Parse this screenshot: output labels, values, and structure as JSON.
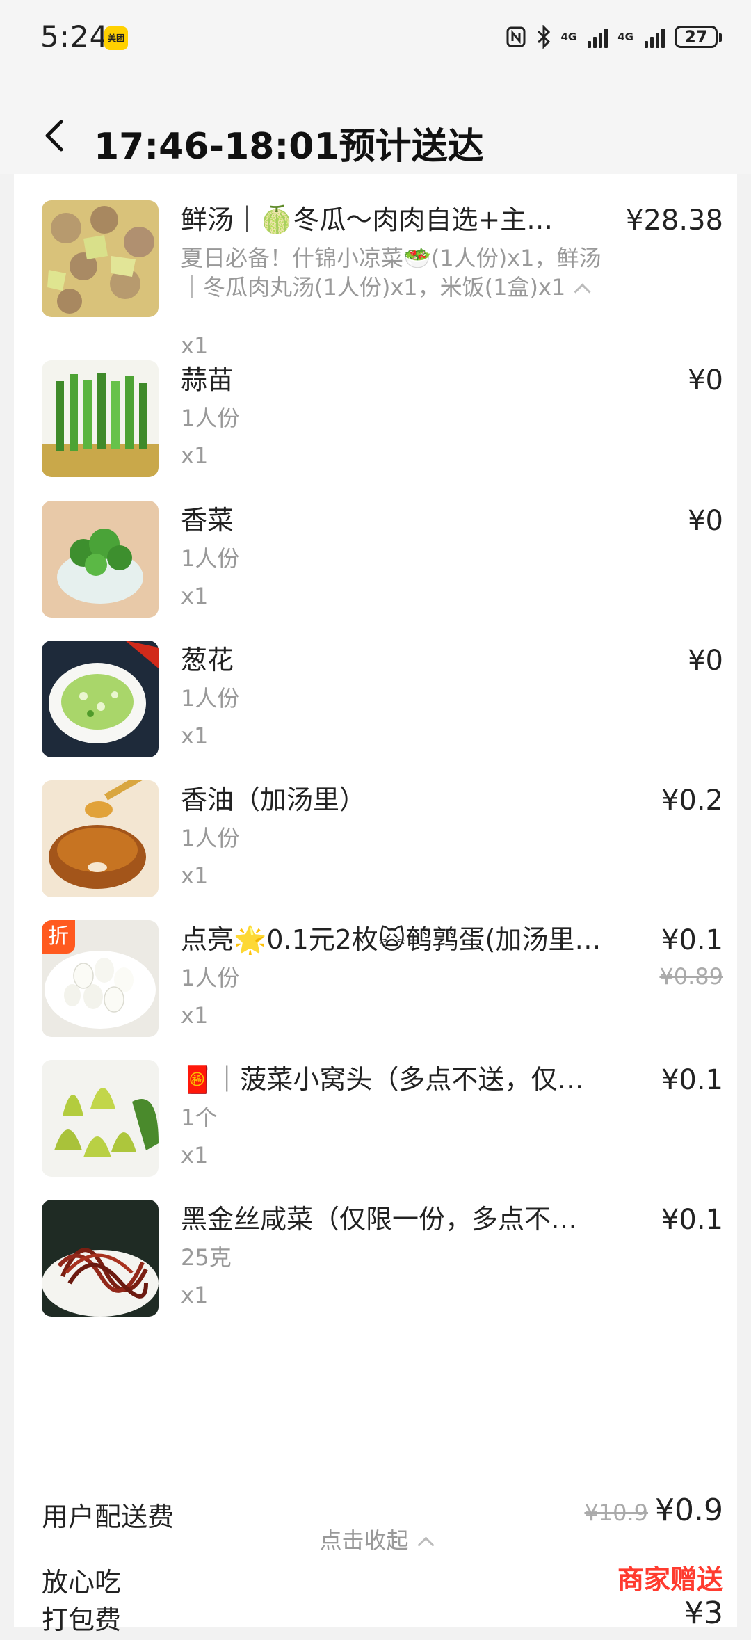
{
  "status_bar": {
    "time": "5:24",
    "app_badge": "美团",
    "network_1": "4G",
    "network_2": "4G",
    "battery": "27"
  },
  "header": {
    "title": "17:46-18:01预计送达"
  },
  "items": [
    {
      "name": "鲜汤｜🍈冬瓜～肉肉自选+主…",
      "spec": "夏日必备！什锦小凉菜🥗(1人份)x1，鲜汤｜冬瓜肉丸汤(1人份)x1，米饭(1盒)x1",
      "qty": "x1",
      "price": "¥28.38"
    },
    {
      "name": "蒜苗",
      "spec": "1人份",
      "qty": "x1",
      "price": "¥0"
    },
    {
      "name": "香菜",
      "spec": "1人份",
      "qty": "x1",
      "price": "¥0"
    },
    {
      "name": "葱花",
      "spec": "1人份",
      "qty": "x1",
      "price": "¥0"
    },
    {
      "name": "香油（加汤里）",
      "spec": "1人份",
      "qty": "x1",
      "price": "¥0.2"
    },
    {
      "name": "点亮🌟0.1元2枚🙀鹌鹑蛋(加汤里…",
      "spec": "1人份",
      "qty": "x1",
      "price": "¥0.1",
      "original_price": "¥0.89",
      "tag": "折"
    },
    {
      "name": "🧧｜菠菜小窝头（多点不送，仅…",
      "spec": "1个",
      "qty": "x1",
      "price": "¥0.1"
    },
    {
      "name": "黑金丝咸菜（仅限一份，多点不…",
      "spec": "25克",
      "qty": "x1",
      "price": "¥0.1"
    }
  ],
  "collapse_label": "点击收起",
  "fees": {
    "packing": {
      "label": "打包费",
      "value": "¥3"
    },
    "delivery": {
      "label": "用户配送费",
      "original": "¥10.9",
      "value": "¥0.9"
    },
    "safe_eat": {
      "label": "放心吃",
      "value": "商家赠送"
    }
  },
  "colors": {
    "accent_red": "#ff3b2f",
    "discount_tag": "#ff5a1f",
    "muted_text": "#999999"
  }
}
